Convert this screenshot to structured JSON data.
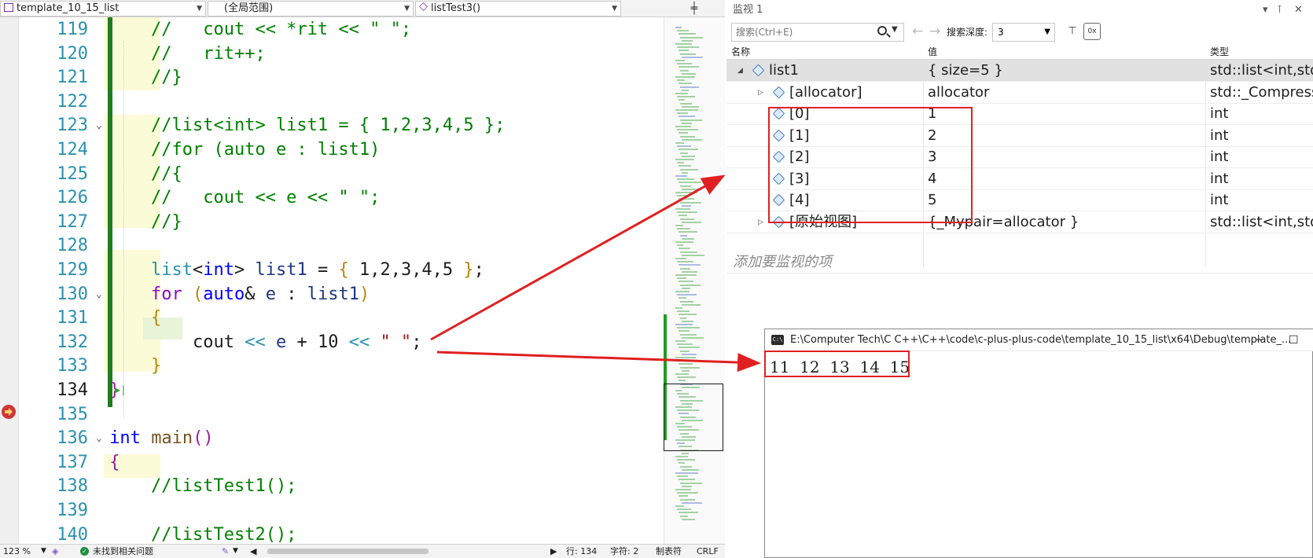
{
  "nav": {
    "file": "template_10_15_list",
    "scope": "(全局范围)",
    "function": "listTest3()"
  },
  "code": {
    "lines": [
      {
        "n": "119",
        "segments": [
          {
            "t": "//   cout << *rit << \" \";",
            "c": "comment"
          }
        ]
      },
      {
        "n": "120",
        "segments": [
          {
            "t": "//   rit++;",
            "c": "comment"
          }
        ]
      },
      {
        "n": "121",
        "segments": [
          {
            "t": "//}",
            "c": "comment"
          }
        ]
      },
      {
        "n": "122",
        "segments": []
      },
      {
        "n": "123",
        "segments": [
          {
            "t": "//list<int> list1 = { 1,2,3,4,5 };",
            "c": "comment"
          }
        ]
      },
      {
        "n": "124",
        "segments": [
          {
            "t": "//for (auto e : list1)",
            "c": "comment"
          }
        ]
      },
      {
        "n": "125",
        "segments": [
          {
            "t": "//{",
            "c": "comment"
          }
        ]
      },
      {
        "n": "126",
        "segments": [
          {
            "t": "//   cout << e << \" \";",
            "c": "comment"
          }
        ]
      },
      {
        "n": "127",
        "segments": [
          {
            "t": "//}",
            "c": "comment"
          }
        ]
      },
      {
        "n": "128",
        "segments": []
      },
      {
        "n": "129",
        "segments": [
          {
            "t": "list",
            "c": "type"
          },
          {
            "t": "<",
            "c": "plain"
          },
          {
            "t": "int",
            "c": "kw"
          },
          {
            "t": "> ",
            "c": "plain"
          },
          {
            "t": "list1",
            "c": "var"
          },
          {
            "t": " = ",
            "c": "plain"
          },
          {
            "t": "{",
            "c": "brk1"
          },
          {
            "t": " 1,2,3,4,5 ",
            "c": "plain"
          },
          {
            "t": "}",
            "c": "brk1"
          },
          {
            "t": ";",
            "c": "plain"
          }
        ]
      },
      {
        "n": "130",
        "segments": [
          {
            "t": "for",
            "c": "ctrl"
          },
          {
            "t": " ",
            "c": "plain"
          },
          {
            "t": "(",
            "c": "brk1"
          },
          {
            "t": "auto",
            "c": "kw"
          },
          {
            "t": "& ",
            "c": "plain"
          },
          {
            "t": "e",
            "c": "var"
          },
          {
            "t": " : ",
            "c": "plain"
          },
          {
            "t": "list1",
            "c": "var"
          },
          {
            "t": ")",
            "c": "brk1"
          }
        ]
      },
      {
        "n": "131",
        "segments": [
          {
            "t": "{",
            "c": "brk1"
          }
        ]
      },
      {
        "n": "132",
        "segments": [
          {
            "t": "    cout",
            "c": "plain"
          },
          {
            "t": " << ",
            "c": "type"
          },
          {
            "t": "e",
            "c": "var"
          },
          {
            "t": " + ",
            "c": "plain"
          },
          {
            "t": "10",
            "c": "plain"
          },
          {
            "t": " << ",
            "c": "type"
          },
          {
            "t": "\" \"",
            "c": "str"
          },
          {
            "t": ";",
            "c": "plain"
          }
        ]
      },
      {
        "n": "133",
        "segments": [
          {
            "t": "}",
            "c": "brk1"
          }
        ]
      },
      {
        "n": "134",
        "segments": [
          {
            "t": "}",
            "c": "brk2"
          }
        ]
      },
      {
        "n": "135",
        "segments": []
      },
      {
        "n": "136",
        "segments": [
          {
            "t": "int",
            "c": "kw"
          },
          {
            "t": " ",
            "c": "plain"
          },
          {
            "t": "main",
            "c": "func"
          },
          {
            "t": "()",
            "c": "brk2"
          }
        ]
      },
      {
        "n": "137",
        "segments": [
          {
            "t": "{",
            "c": "brk2"
          }
        ]
      },
      {
        "n": "138",
        "segments": [
          {
            "t": "//listTest1();",
            "c": "comment"
          }
        ]
      },
      {
        "n": "139",
        "segments": []
      },
      {
        "n": "140",
        "segments": [
          {
            "t": "//listTest2();",
            "c": "comment"
          }
        ]
      }
    ]
  },
  "status": {
    "zoom": "123 %",
    "issues": "未找到相关问题",
    "row": "行: 134",
    "col": "字符: 2",
    "indent": "制表符",
    "eol": "CRLF"
  },
  "watch": {
    "title": "监视 1",
    "search_placeholder": "搜索(Ctrl+E)",
    "depth_label": "搜索深度:",
    "depth_value": "3",
    "columns": {
      "name": "名称",
      "value": "值",
      "type": "类型"
    },
    "rows": [
      {
        "name": "list1",
        "value": "{ size=5 }",
        "type": "std::list<int,std::allocator<int>>",
        "level": 0,
        "expander": "◢"
      },
      {
        "name": "[allocator]",
        "value": "allocator",
        "type": "std::_Compressed_pair",
        "level": 1,
        "expander": "▷"
      },
      {
        "name": "[0]",
        "value": "1",
        "type": "int",
        "level": 1,
        "expander": ""
      },
      {
        "name": "[1]",
        "value": "2",
        "type": "int",
        "level": 1,
        "expander": ""
      },
      {
        "name": "[2]",
        "value": "3",
        "type": "int",
        "level": 1,
        "expander": ""
      },
      {
        "name": "[3]",
        "value": "4",
        "type": "int",
        "level": 1,
        "expander": ""
      },
      {
        "name": "[4]",
        "value": "5",
        "type": "int",
        "level": 1,
        "expander": ""
      },
      {
        "name": "[原始视图]",
        "value": "{_Mypair=allocator }",
        "type": "std::list<int,std::allocator<int>>",
        "level": 1,
        "expander": "▷"
      }
    ],
    "add_item": "添加要监视的项"
  },
  "console": {
    "title": "E:\\Computer Tech\\C C++\\C++\\code\\c-plus-plus-code\\template_10_15_list\\x64\\Debug\\template_...",
    "output": "11  12  13  14  15"
  },
  "colors": {
    "annotation": "#e02020",
    "change_bar": "#1f7d1f"
  }
}
